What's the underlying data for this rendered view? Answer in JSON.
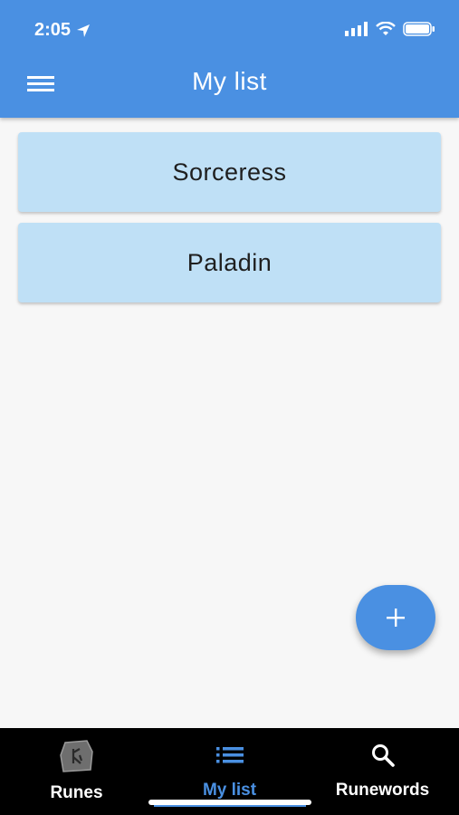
{
  "status_bar": {
    "time": "2:05"
  },
  "app_bar": {
    "title": "My list"
  },
  "list": {
    "items": [
      {
        "label": "Sorceress"
      },
      {
        "label": "Paladin"
      }
    ]
  },
  "fab": {
    "icon": "plus-icon",
    "symbol": "+"
  },
  "bottom_nav": {
    "items": [
      {
        "label": "Runes",
        "icon": "rune-stone-icon"
      },
      {
        "label": "My list",
        "icon": "list-icon",
        "active": true
      },
      {
        "label": "Runewords",
        "icon": "search-icon"
      }
    ]
  },
  "colors": {
    "primary": "#4a90e2",
    "card": "#bfe0f6",
    "nav_bg": "#000000",
    "background": "#f7f7f7"
  }
}
